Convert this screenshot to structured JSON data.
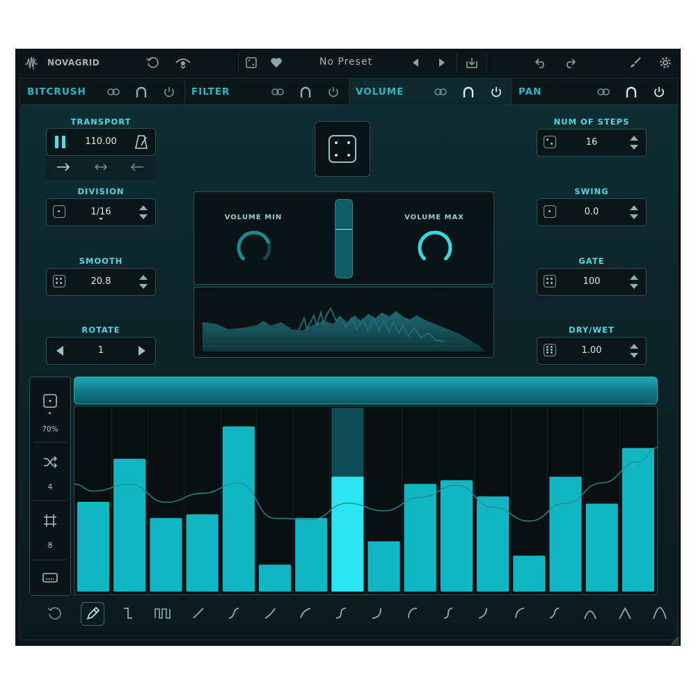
{
  "app": {
    "brand": "NOVAGRID",
    "preset_name": "No Preset"
  },
  "tabs": [
    {
      "label": "BITCRUSH",
      "active": false
    },
    {
      "label": "FILTER",
      "active": false
    },
    {
      "label": "VOLUME",
      "active": true
    },
    {
      "label": "PAN",
      "active": false
    }
  ],
  "transport": {
    "label": "TRANSPORT",
    "bpm": "110.00"
  },
  "division": {
    "label": "DIVISION",
    "value": "1/16"
  },
  "smooth": {
    "label": "SMOOTH",
    "value": "20.8"
  },
  "rotate": {
    "label": "ROTATE",
    "value": "1"
  },
  "num_steps": {
    "label": "NUM OF STEPS",
    "value": "16"
  },
  "swing": {
    "label": "SWING",
    "value": "0.0"
  },
  "gate": {
    "label": "GATE",
    "value": "100"
  },
  "dry_wet": {
    "label": "DRY/WET",
    "value": "1.00"
  },
  "volume": {
    "min_label": "VOLUME MIN",
    "max_label": "VOLUME MAX",
    "min_level": 0.75,
    "max_level": 1.0
  },
  "sequencer": {
    "probability": "70%",
    "shuffle": "4",
    "grid": "8",
    "active_step": 8,
    "steps": [
      0.5,
      0.74,
      0.41,
      0.43,
      0.92,
      0.15,
      0.41,
      0.64,
      0.28,
      0.6,
      0.62,
      0.53,
      0.2,
      0.64,
      0.49,
      0.8
    ]
  },
  "colors": {
    "accent": "#2bc3d0",
    "accent_bright": "#2be4ef",
    "background": "#0b1416",
    "bar": "#11b6c3"
  }
}
